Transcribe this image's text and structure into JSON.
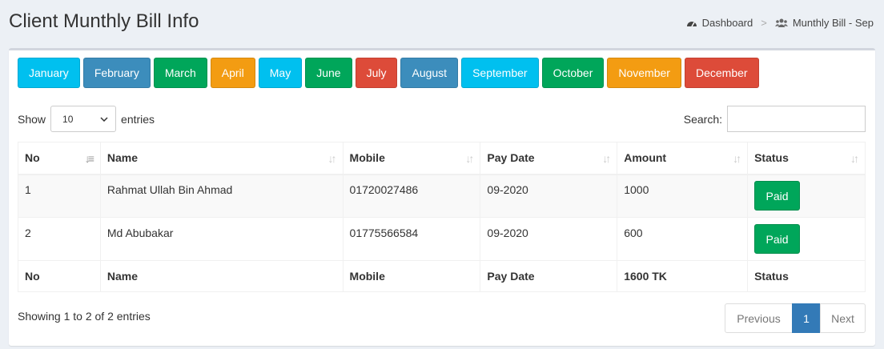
{
  "header": {
    "title": "Client Munthly Bill Info",
    "breadcrumb": {
      "home": "Dashboard",
      "separator": ">",
      "current": "Munthly Bill - Sep"
    }
  },
  "months": [
    {
      "label": "January",
      "color": "#00c0ef"
    },
    {
      "label": "February",
      "color": "#3c8dbc"
    },
    {
      "label": "March",
      "color": "#00a65a"
    },
    {
      "label": "April",
      "color": "#f39c12"
    },
    {
      "label": "May",
      "color": "#00c0ef"
    },
    {
      "label": "June",
      "color": "#00a65a"
    },
    {
      "label": "July",
      "color": "#dd4b39"
    },
    {
      "label": "August",
      "color": "#3c8dbc"
    },
    {
      "label": "September",
      "color": "#00c0ef"
    },
    {
      "label": "October",
      "color": "#00a65a"
    },
    {
      "label": "November",
      "color": "#f39c12"
    },
    {
      "label": "December",
      "color": "#dd4b39"
    }
  ],
  "controls": {
    "show_label": "Show",
    "entries_value": "10",
    "entries_label": "entries",
    "search_label": "Search:",
    "search_value": ""
  },
  "table": {
    "columns": [
      "No",
      "Name",
      "Mobile",
      "Pay Date",
      "Amount",
      "Status"
    ],
    "rows": [
      {
        "no": "1",
        "name": "Rahmat Ullah Bin Ahmad",
        "mobile": "01720027486",
        "pay_date": "09-2020",
        "amount": "1000",
        "status": "Paid"
      },
      {
        "no": "2",
        "name": "Md Abubakar",
        "mobile": "01775566584",
        "pay_date": "09-2020",
        "amount": "600",
        "status": "Paid"
      }
    ],
    "footer": [
      "No",
      "Name",
      "Mobile",
      "Pay Date",
      "1600 TK",
      "Status"
    ]
  },
  "footer": {
    "info": "Showing 1 to 2 of 2 entries",
    "pagination": {
      "previous": "Previous",
      "current": "1",
      "next": "Next"
    }
  },
  "colors": {
    "paid": "#00a65a",
    "page_active": "#337ab7"
  }
}
